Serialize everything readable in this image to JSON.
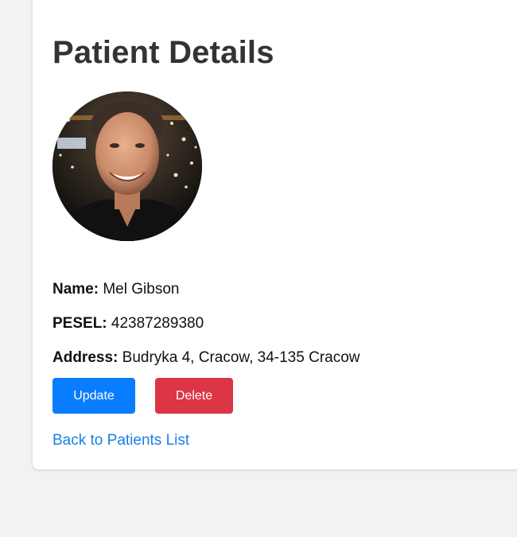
{
  "page": {
    "title": "Patient Details"
  },
  "patient": {
    "photo_alt": "Patient photo",
    "fields": [
      {
        "label": "Name:",
        "value": "Mel Gibson"
      },
      {
        "label": "PESEL:",
        "value": "42387289380"
      },
      {
        "label": "Address:",
        "value": "Budryka 4, Cracow, 34-135 Cracow"
      }
    ]
  },
  "actions": {
    "update_label": "Update",
    "delete_label": "Delete",
    "back_label": "Back to Patients List"
  },
  "colors": {
    "update": "#0a7cff",
    "delete": "#dc3545",
    "link": "#1a7fe6",
    "title": "#333333"
  }
}
